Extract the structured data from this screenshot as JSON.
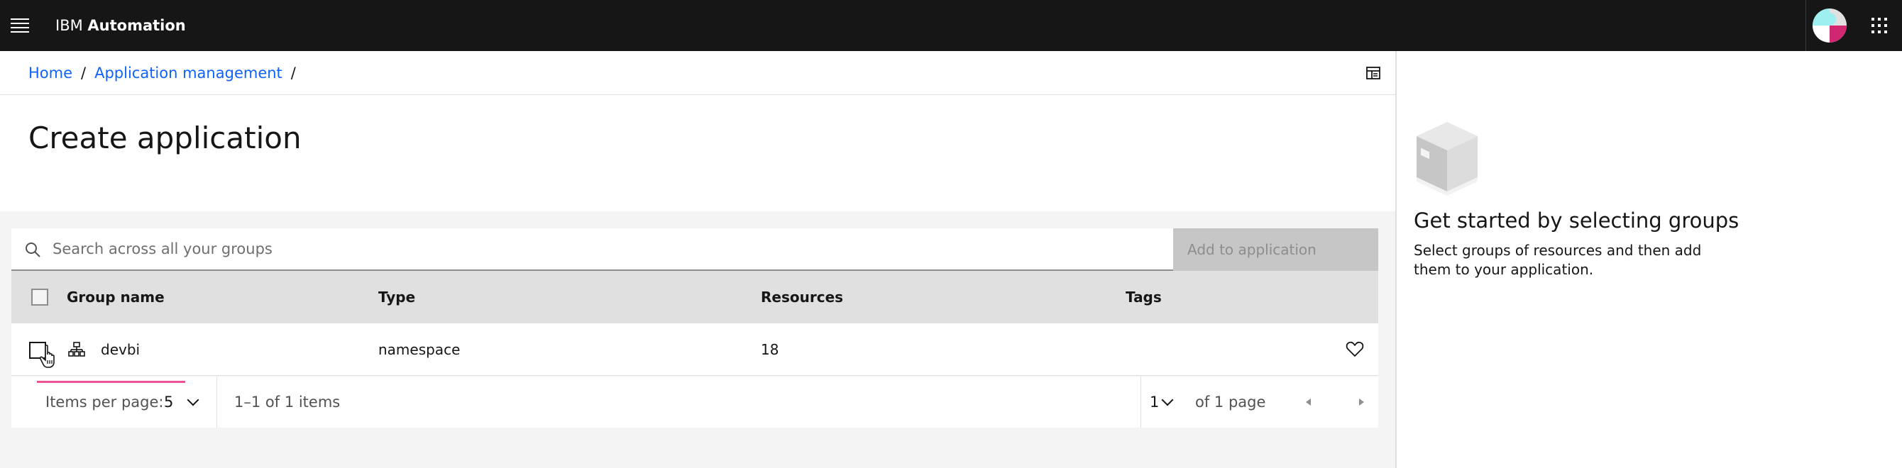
{
  "header": {
    "brand_prefix": "IBM",
    "brand_name": "Automation"
  },
  "breadcrumb": {
    "items": [
      "Home",
      "Application management"
    ],
    "separator": "/"
  },
  "page": {
    "title": "Create application"
  },
  "toolbar": {
    "search_placeholder": "Search across all your groups",
    "search_value": "",
    "add_button_label": "Add to application"
  },
  "table": {
    "columns": [
      "Group name",
      "Type",
      "Resources",
      "Tags"
    ],
    "rows": [
      {
        "group_name": "devbi",
        "type": "namespace",
        "resources": "18",
        "tags": ""
      }
    ]
  },
  "pagination": {
    "items_per_page_label": "Items per page:",
    "items_per_page_value": "5",
    "range_text": "1–1 of 1 items",
    "page_value": "1",
    "of_pages_text": "of 1 page"
  },
  "side_panel": {
    "heading": "Get started by selecting groups",
    "description": "Select groups of resources and then add them to your application."
  },
  "colors": {
    "header_bg": "#161616",
    "link": "#0f62fe",
    "focus_accent": "#ee5396",
    "avatar_teal": "#9ef0f0",
    "avatar_magenta": "#d12771"
  },
  "icons": [
    "menu-icon",
    "app-switcher-icon",
    "avatar",
    "layout-toggle-icon",
    "search-icon",
    "group-icon",
    "pointer-cursor-icon",
    "favorite-heart-icon",
    "chevron-down-icon",
    "caret-left-icon",
    "caret-right-icon",
    "empty-box-illustration"
  ]
}
